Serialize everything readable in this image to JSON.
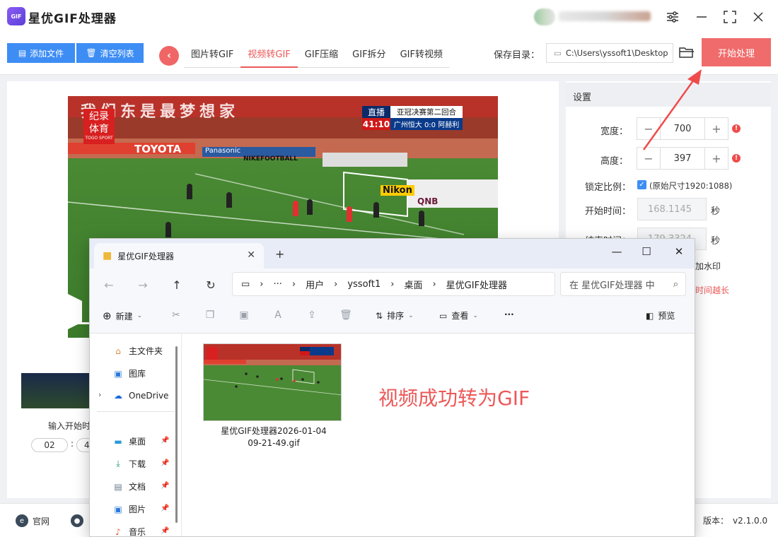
{
  "app": {
    "title": "星优GIF处理器",
    "logo_text": "GIF"
  },
  "toolbar": {
    "add_file": "添加文件",
    "clear_list": "清空列表",
    "tabs": [
      "图片转GIF",
      "视频转GIF",
      "GIF压缩",
      "GIF拆分",
      "GIF转视频"
    ],
    "active_tab": "视频转GIF",
    "save_label": "保存目录：",
    "save_path": "C:\\Users\\yssoft1\\Desktop",
    "start": "开始处理"
  },
  "video": {
    "banner": "我们东是最梦想家",
    "logo_line1": "纪录",
    "logo_line2": "体育",
    "logo_sub": "TOGO SPORT",
    "live_tag": "直播",
    "match": "亚冠决赛第二回合",
    "clock": "41:10",
    "score": "广州恒大 0:0 阿赫利",
    "sponsors": [
      "TOYOTA",
      "Panasonic",
      "NIKEFOOTBALL",
      "Nikon",
      "QNB"
    ]
  },
  "left": {
    "input_label": "输入开始时",
    "time_h": "02",
    "time_sep": ":",
    "time_m": "4"
  },
  "settings": {
    "header": "设置",
    "width_label": "宽度：",
    "width_value": "700",
    "height_label": "高度：",
    "height_value": "397",
    "lock_label": "锁定比例：",
    "lock_note": "(原始尺寸1920:1088)",
    "start_label": "开始时间：",
    "start_value": "168.1145",
    "end_label": "结束时间：",
    "end_value": "179.3324",
    "unit": "秒",
    "watermark_partial": "加水印",
    "warning_partial": "时间越长"
  },
  "bottom": {
    "site": "官网",
    "version_label": "版本：",
    "version": "v2.1.0.0"
  },
  "explorer": {
    "tab_title": "星优GIF处理器",
    "breadcrumb": [
      "用户",
      "yssoft1",
      "桌面",
      "星优GIF处理器"
    ],
    "search_placeholder": "在 星优GIF处理器 中",
    "cmd": {
      "new": "新建",
      "sort": "排序",
      "view": "查看",
      "preview": "预览"
    },
    "nav": {
      "home": "主文件夹",
      "gallery": "图库",
      "onedrive": "OneDrive",
      "desktop": "桌面",
      "downloads": "下载",
      "documents": "文档",
      "pictures": "图片",
      "music": "音乐"
    },
    "file_name_1": "星优GIF处理器2026-01-04",
    "file_name_2": "09-21-49.gif",
    "success_text": "视频成功转为GIF"
  },
  "colors": {
    "accent_red": "#ec5858",
    "blue": "#3d8df5",
    "start_btn": "#f06b6b"
  }
}
